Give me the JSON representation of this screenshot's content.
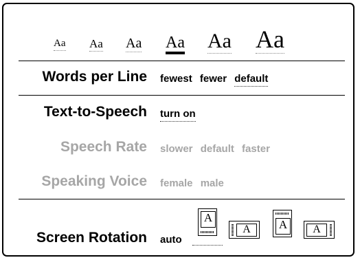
{
  "font_sizes": {
    "options": [
      {
        "label": "Aa",
        "selected": false
      },
      {
        "label": "Aa",
        "selected": false
      },
      {
        "label": "Aa",
        "selected": false
      },
      {
        "label": "Aa",
        "selected": true
      },
      {
        "label": "Aa",
        "selected": false
      },
      {
        "label": "Aa",
        "selected": false
      }
    ]
  },
  "words_per_line": {
    "label": "Words per Line",
    "options": [
      "fewest",
      "fewer",
      "default"
    ],
    "selected": "default"
  },
  "text_to_speech": {
    "label": "Text-to-Speech",
    "option": "turn on"
  },
  "speech_rate": {
    "label": "Speech Rate",
    "options": [
      "slower",
      "default",
      "faster"
    ],
    "enabled": false
  },
  "speaking_voice": {
    "label": "Speaking Voice",
    "options": [
      "female",
      "male"
    ],
    "enabled": false
  },
  "screen_rotation": {
    "label": "Screen Rotation",
    "auto_label": "auto",
    "icon_glyph": "A",
    "icons": [
      "portrait-bottom-bar-icon",
      "landscape-left-bar-icon",
      "portrait-top-bar-icon",
      "landscape-right-bar-icon"
    ],
    "selected_icon": "portrait-bottom-bar-icon"
  },
  "colors": {
    "text": "#000000",
    "disabled_text": "#a6a6a6",
    "background": "#ffffff"
  }
}
